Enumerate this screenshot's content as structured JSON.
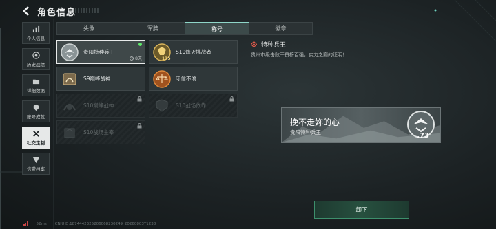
{
  "header": {
    "title": "角色信息"
  },
  "sidebar": {
    "items": [
      {
        "label": "个人信息",
        "icon": "bar-chart-icon",
        "active": false
      },
      {
        "label": "历史战绩",
        "icon": "record-icon",
        "active": false
      },
      {
        "label": "详细数据",
        "icon": "folder-icon",
        "active": false
      },
      {
        "label": "账号成就",
        "icon": "medal-icon",
        "active": false
      },
      {
        "label": "社交定制",
        "icon": "tools-icon",
        "active": true
      },
      {
        "label": "信誉档案",
        "icon": "shield-icon",
        "active": false
      }
    ]
  },
  "tabs": [
    {
      "label": "头像",
      "active": false
    },
    {
      "label": "军牌",
      "active": false
    },
    {
      "label": "称号",
      "active": true
    },
    {
      "label": "徽章",
      "active": false
    }
  ],
  "titles": [
    {
      "name": "贵阳特种兵王",
      "state": "selected",
      "days": "8天",
      "badge": "eagle-badge-icon"
    },
    {
      "name": "S10烽火挑战者",
      "state": "normal",
      "badge_num": "175",
      "badge": "golden-wing-badge-icon"
    },
    {
      "name": "S9巅峰战神",
      "state": "normal",
      "badge": "laurel-badge-icon"
    },
    {
      "name": "守信不渝",
      "state": "normal",
      "badge": "scales-badge-icon"
    },
    {
      "name": "S10巅峰战神",
      "state": "locked",
      "badge": "locked-laurel-badge-icon"
    },
    {
      "name": "S10战场依靠",
      "state": "locked",
      "badge": "locked-shield-badge-icon"
    },
    {
      "name": "S10战场主宰",
      "state": "locked",
      "badge": "locked-crown-badge-icon"
    }
  ],
  "detail": {
    "name": "特种兵王",
    "description": "贵州市级击败干员榜百强，实力之巅的证明！"
  },
  "preview": {
    "signature": "挽不走妳的心",
    "subtitle": "贵阳特种兵王",
    "number": ".73"
  },
  "action": {
    "unequip_label": "卸下"
  },
  "footer": {
    "ping": "52ms",
    "uid": "CN UID:1874442325206068230249_20260803T1238"
  },
  "colors": {
    "accent": "#8fd6c8",
    "active_dot": "#5ee86a",
    "button": "#27503f"
  }
}
